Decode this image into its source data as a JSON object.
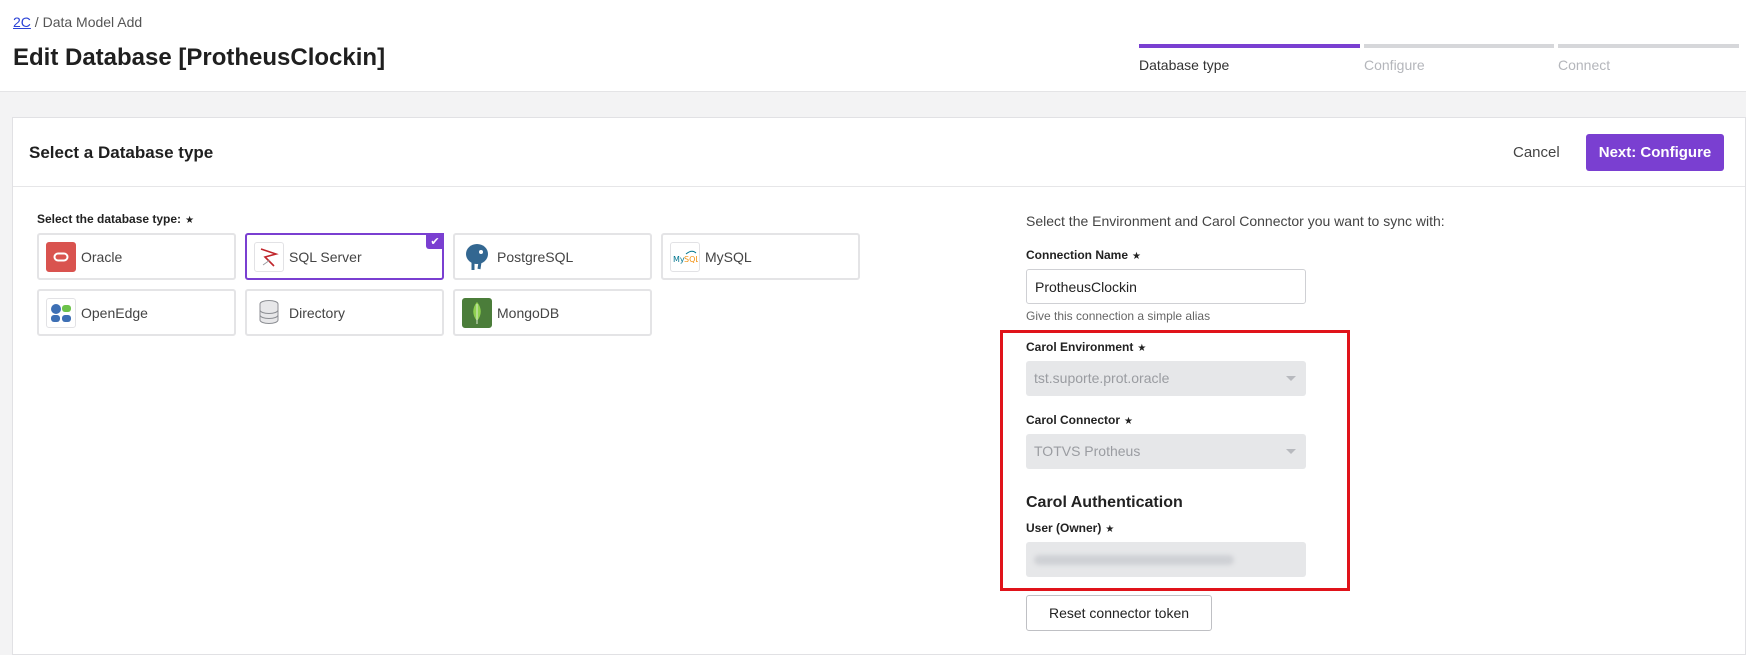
{
  "breadcrumb": {
    "root_link": "2C",
    "separator": "/",
    "current": "Data Model Add"
  },
  "page": {
    "title": "Edit Database [ProtheusClockin]"
  },
  "steps": [
    {
      "label": "Database type",
      "active": true
    },
    {
      "label": "Configure",
      "active": false
    },
    {
      "label": "Connect",
      "active": false
    }
  ],
  "card": {
    "title": "Select a Database type",
    "cancel_label": "Cancel",
    "next_label": "Next: Configure"
  },
  "db_select": {
    "label": "Select the database type:",
    "required_mark": "★",
    "selected": "SQL Server",
    "options": [
      {
        "name": "Oracle",
        "icon": "oracle-icon"
      },
      {
        "name": "SQL Server",
        "icon": "sql-server-icon"
      },
      {
        "name": "PostgreSQL",
        "icon": "postgresql-icon"
      },
      {
        "name": "MySQL",
        "icon": "mysql-icon"
      },
      {
        "name": "OpenEdge",
        "icon": "openedge-icon"
      },
      {
        "name": "Directory",
        "icon": "directory-icon"
      },
      {
        "name": "MongoDB",
        "icon": "mongodb-icon"
      }
    ],
    "checkmark": "✔"
  },
  "sync": {
    "intro": "Select the Environment and Carol Connector you want to sync with:",
    "connection_name_label": "Connection Name",
    "connection_name_value": "ProtheusClockin",
    "connection_name_hint": "Give this connection a simple alias",
    "environment_label": "Carol Environment",
    "environment_value": "tst.suporte.prot.oracle",
    "connector_label": "Carol Connector",
    "connector_value": "TOTVS Protheus",
    "auth_title": "Carol Authentication",
    "user_label": "User (Owner)",
    "reset_label": "Reset connector token"
  },
  "colors": {
    "accent": "#7a3fd1",
    "highlight": "#e0131a"
  }
}
